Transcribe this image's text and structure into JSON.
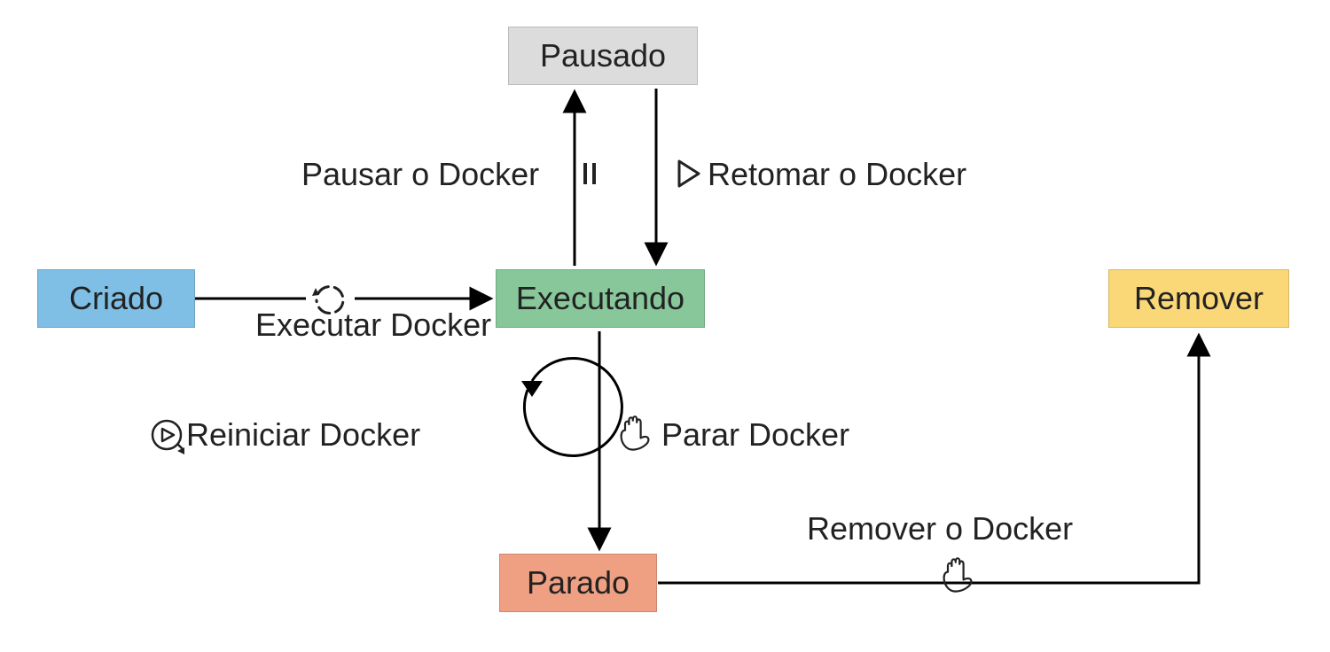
{
  "states": {
    "criado": {
      "label": "Criado",
      "color": "#7FBFE6"
    },
    "executando": {
      "label": "Executando",
      "color": "#87C79A"
    },
    "pausado": {
      "label": "Pausado",
      "color": "#DCDCDC"
    },
    "parado": {
      "label": "Parado",
      "color": "#EFA083"
    },
    "remover": {
      "label": "Remover",
      "color": "#FBD877"
    }
  },
  "transitions": {
    "executar": {
      "label": "Executar Docker"
    },
    "pausar": {
      "label": "Pausar o Docker"
    },
    "retomar": {
      "label": "Retomar o Docker"
    },
    "reiniciar": {
      "label": "Reiniciar Docker"
    },
    "parar": {
      "label": "Parar Docker"
    },
    "remover": {
      "label": "Remover o Docker"
    }
  }
}
